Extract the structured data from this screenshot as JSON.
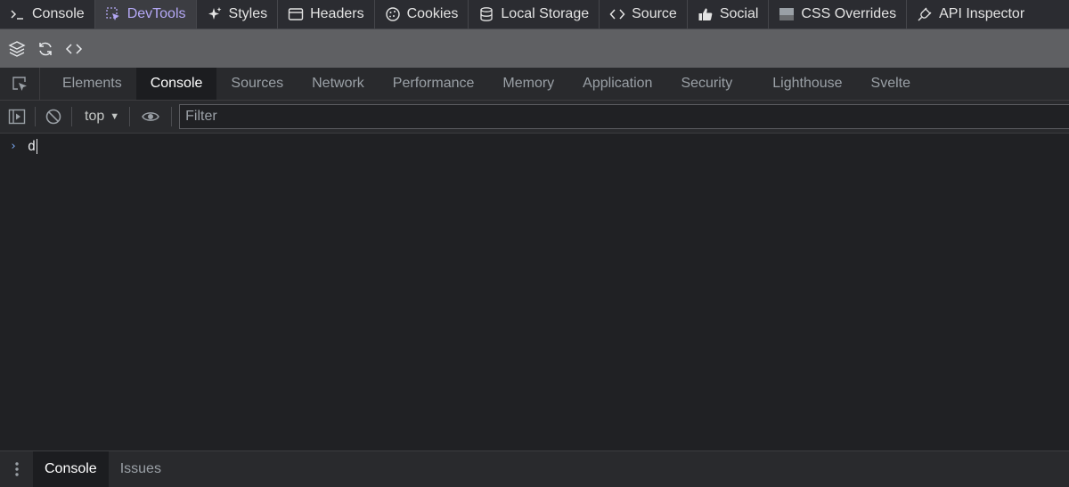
{
  "extension_tabs": [
    {
      "label": "Console",
      "icon": "terminal-icon"
    },
    {
      "label": "DevTools",
      "icon": "cursor-icon",
      "active": true
    },
    {
      "label": "Styles",
      "icon": "sparkle-icon"
    },
    {
      "label": "Headers",
      "icon": "window-icon"
    },
    {
      "label": "Cookies",
      "icon": "cookie-icon"
    },
    {
      "label": "Local Storage",
      "icon": "database-icon"
    },
    {
      "label": "Source",
      "icon": "code-icon"
    },
    {
      "label": "Social",
      "icon": "thumbs-up-icon"
    },
    {
      "label": "CSS Overrides",
      "icon": "css-icon"
    },
    {
      "label": "API Inspector",
      "icon": "plug-icon"
    }
  ],
  "sub_bar": {
    "icons": [
      "layers-icon",
      "refresh-icon",
      "code-icon"
    ]
  },
  "panel_tabs": [
    {
      "label": "Elements"
    },
    {
      "label": "Console",
      "active": true
    },
    {
      "label": "Sources"
    },
    {
      "label": "Network"
    },
    {
      "label": "Performance"
    },
    {
      "label": "Memory"
    },
    {
      "label": "Application"
    },
    {
      "label": "Security"
    },
    {
      "label": "Lighthouse"
    },
    {
      "label": "Svelte"
    }
  ],
  "console_toolbar": {
    "context": "top",
    "filter_placeholder": "Filter",
    "filter_value": ""
  },
  "console": {
    "prompt_symbol": "›",
    "input_text": "d"
  },
  "drawer": {
    "tabs": [
      {
        "label": "Console",
        "active": true
      },
      {
        "label": "Issues"
      }
    ]
  },
  "colors": {
    "background": "#202124",
    "ext_bar": "#2b2c31",
    "sub_bar": "#5f6063",
    "active_ext_tab_text": "#b4a8f5",
    "prompt_accent": "#7cacf8"
  }
}
